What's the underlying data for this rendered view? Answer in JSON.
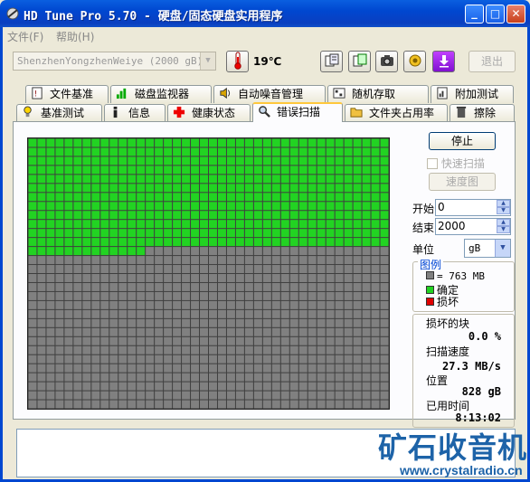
{
  "window": {
    "title": "HD Tune Pro 5.70 - 硬盘/固态硬盘实用程序",
    "min_label": "_",
    "max_label": "□",
    "close_label": "✕"
  },
  "menu": {
    "file": "文件(F)",
    "help": "帮助(H)"
  },
  "toolbar": {
    "drive": "ShenzhenYongzhenWeiye (2000 gB)",
    "temperature": "19℃",
    "exit_label": "退出",
    "icons": [
      "info-copy-icon",
      "copy-icon",
      "camera-icon",
      "options-icon",
      "download-icon"
    ]
  },
  "tabs_top": [
    {
      "label": "文件基准",
      "icon": "file-bench-icon"
    },
    {
      "label": "磁盘监视器",
      "icon": "disk-monitor-icon"
    },
    {
      "label": "自动噪音管理",
      "icon": "speaker-icon"
    },
    {
      "label": "随机存取",
      "icon": "random-access-icon"
    },
    {
      "label": "附加测试",
      "icon": "extra-tests-icon"
    }
  ],
  "tabs_bottom": [
    {
      "label": "基准测试",
      "icon": "benchmark-icon"
    },
    {
      "label": "信息",
      "icon": "info-icon"
    },
    {
      "label": "健康状态",
      "icon": "health-cross-icon"
    },
    {
      "label": "错误扫描",
      "icon": "magnifier-icon",
      "active": true
    },
    {
      "label": "文件夹占用率",
      "icon": "folder-icon"
    },
    {
      "label": "擦除",
      "icon": "trash-icon"
    }
  ],
  "scan": {
    "stop_label": "停止",
    "quick_scan_label": "快速扫描",
    "speed_map_label": "速度图",
    "start_label": "开始",
    "start_value": "0",
    "end_label": "结束",
    "end_value": "2000",
    "unit_label": "单位",
    "unit_value": "gB",
    "grid_cols": 40,
    "grid_rows": 30,
    "blocks_scanned": 493,
    "colors": {
      "ok": "#22d322",
      "untested": "#808080",
      "damaged": "#e00000",
      "grid_line": "#3f3f3f"
    }
  },
  "legend": {
    "title": "图例",
    "block_size": "= 763 MB",
    "ok": "确定",
    "damaged": "损坏"
  },
  "stats": {
    "damaged_blocks_label": "损坏的块",
    "damaged_blocks_value": "0.0 %",
    "scan_speed_label": "扫描速度",
    "scan_speed_value": "27.3 MB/s",
    "position_label": "位置",
    "position_value": "828 gB",
    "elapsed_label": "已用时间",
    "elapsed_value": "8:13:02"
  },
  "watermark": {
    "cn": "矿石收音机",
    "url": "www.crystalradio.cn"
  }
}
